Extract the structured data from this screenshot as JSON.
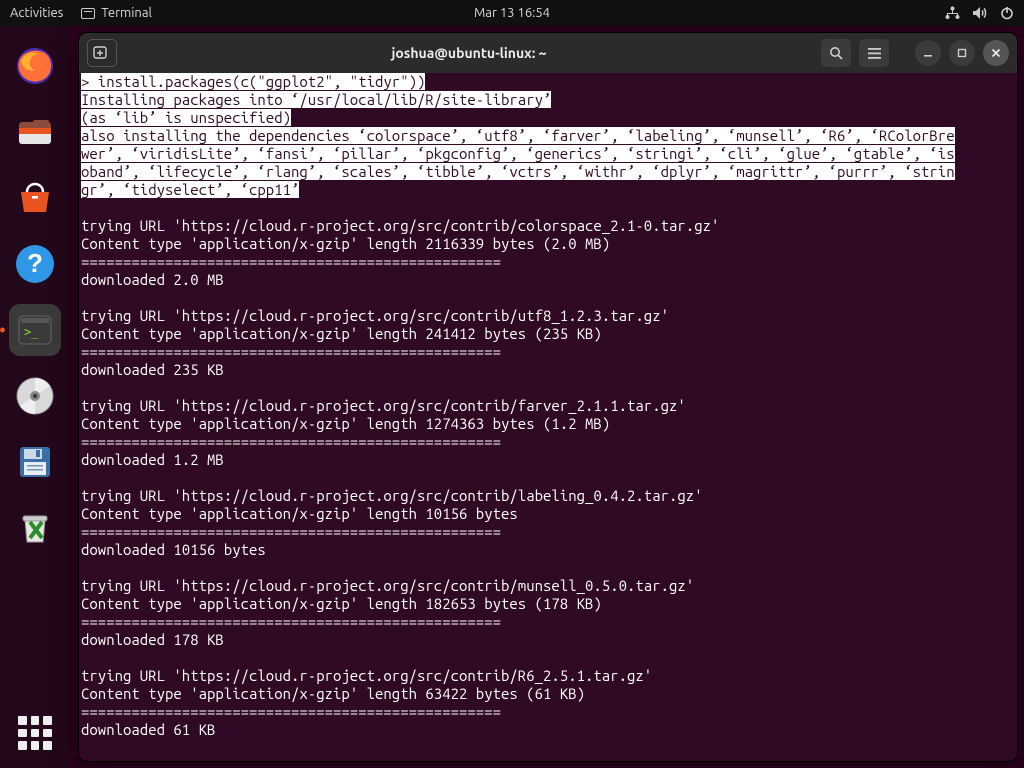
{
  "topbar": {
    "activities": "Activities",
    "app_label": "Terminal",
    "clock": "Mar 13  16:54"
  },
  "dock": {
    "items": [
      {
        "name": "firefox",
        "color": "#ff7139"
      },
      {
        "name": "files",
        "color": "#e95420"
      },
      {
        "name": "software",
        "color": "#e95420"
      },
      {
        "name": "help",
        "color": "#2e98e6"
      },
      {
        "name": "terminal",
        "color": "#2d2d2d",
        "active": true
      },
      {
        "name": "disc",
        "color": "#bfbfbf"
      },
      {
        "name": "save",
        "color": "#3b6ea5"
      },
      {
        "name": "trash",
        "color": "#d9d9d9"
      }
    ]
  },
  "window": {
    "title": "joshua@ubuntu-linux: ~"
  },
  "terminal": {
    "highlight": "> install.packages(c(\"ggplot2\", \"tidyr\"))\nInstalling packages into ‘/usr/local/lib/R/site-library’\n(as ‘lib’ is unspecified)\nalso installing the dependencies ‘colorspace’, ‘utf8’, ‘farver’, ‘labeling’, ‘munsell’, ‘R6’, ‘RColorBre\nwer’, ‘viridisLite’, ‘fansi’, ‘pillar’, ‘pkgconfig’, ‘generics’, ‘stringi’, ‘cli’, ‘glue’, ‘gtable’, ‘is\noband’, ‘lifecycle’, ‘rlang’, ‘scales’, ‘tibble’, ‘vctrs’, ‘withr’, ‘dplyr’, ‘magrittr’, ‘purrr’, ‘strin\ngr’, ‘tidyselect’, ‘cpp11’",
    "body": "\ntrying URL 'https://cloud.r-project.org/src/contrib/colorspace_2.1-0.tar.gz'\nContent type 'application/x-gzip' length 2116339 bytes (2.0 MB)\n==================================================\ndownloaded 2.0 MB\n\ntrying URL 'https://cloud.r-project.org/src/contrib/utf8_1.2.3.tar.gz'\nContent type 'application/x-gzip' length 241412 bytes (235 KB)\n==================================================\ndownloaded 235 KB\n\ntrying URL 'https://cloud.r-project.org/src/contrib/farver_2.1.1.tar.gz'\nContent type 'application/x-gzip' length 1274363 bytes (1.2 MB)\n==================================================\ndownloaded 1.2 MB\n\ntrying URL 'https://cloud.r-project.org/src/contrib/labeling_0.4.2.tar.gz'\nContent type 'application/x-gzip' length 10156 bytes\n==================================================\ndownloaded 10156 bytes\n\ntrying URL 'https://cloud.r-project.org/src/contrib/munsell_0.5.0.tar.gz'\nContent type 'application/x-gzip' length 182653 bytes (178 KB)\n==================================================\ndownloaded 178 KB\n\ntrying URL 'https://cloud.r-project.org/src/contrib/R6_2.5.1.tar.gz'\nContent type 'application/x-gzip' length 63422 bytes (61 KB)\n==================================================\ndownloaded 61 KB"
  }
}
